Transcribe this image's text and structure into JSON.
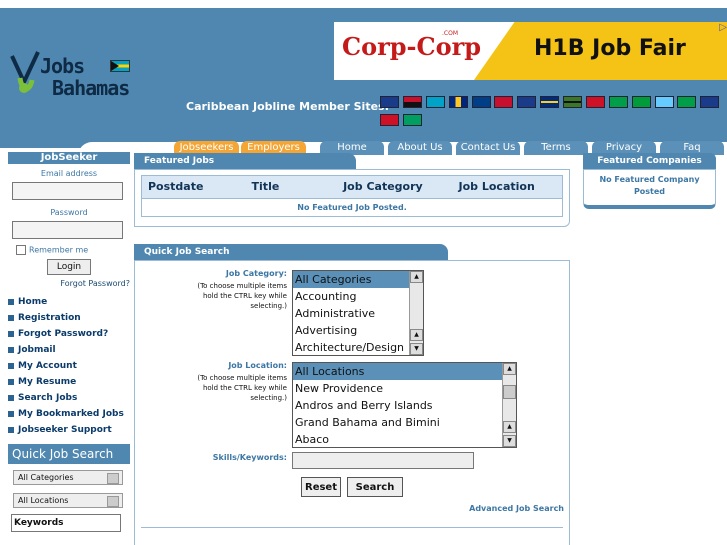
{
  "logo": {
    "line1": "Jobs",
    "line2": "Bahamas"
  },
  "ad": {
    "brand": "Corp-Corp",
    "brand_suffix": ".COM",
    "headline": "H1B Job Fair",
    "corner_icon": "ad-choices-icon"
  },
  "members": {
    "label": "Caribbean Jobline Member Sites:"
  },
  "nav": {
    "tabs": [
      {
        "label": "Jobseekers"
      },
      {
        "label": "Employers"
      },
      {
        "label": "Home"
      },
      {
        "label": "About Us"
      },
      {
        "label": "Contact Us"
      },
      {
        "label": "Terms"
      },
      {
        "label": "Privacy"
      },
      {
        "label": "Faq"
      }
    ]
  },
  "sidebar": {
    "title": "JobSeeker",
    "email_label": "Email address",
    "password_label": "Password",
    "remember_label": "Remember me",
    "login_label": "Login",
    "forgot_label": "Forgot Password?",
    "menu": [
      {
        "label": "Home"
      },
      {
        "label": "Registration"
      },
      {
        "label": "Forgot Password?"
      },
      {
        "label": "Jobmail"
      },
      {
        "label": "My Account"
      },
      {
        "label": "My Resume"
      },
      {
        "label": "Search Jobs"
      },
      {
        "label": "My Bookmarked Jobs"
      },
      {
        "label": "Jobseeker Support"
      }
    ],
    "quick_search_title": "Quick Job Search",
    "category_select": "All Categories",
    "location_select": "All Locations",
    "keywords_label": "Keywords"
  },
  "featured_jobs": {
    "title": "Featured Jobs",
    "columns": [
      "Postdate",
      "Title",
      "Job Category",
      "Job Location"
    ],
    "empty_message": "No Featured Job Posted."
  },
  "quick_search": {
    "title": "Quick Job Search",
    "category_label": "Job Category:",
    "category_note": "(To choose multiple items hold the CTRL key while selecting.)",
    "categories": [
      "All Categories",
      "Accounting",
      "Administrative",
      "Advertising",
      "Architecture/Design"
    ],
    "location_label": "Job Location:",
    "location_note": "(To choose multiple items hold the CTRL key while selecting.)",
    "locations": [
      "All Locations",
      "New Providence",
      "Andros and Berry Islands",
      "Grand Bahama and Bimini",
      "Abaco"
    ],
    "skills_label": "Skills/Keywords:",
    "skills_value": "",
    "reset_label": "Reset",
    "search_label": "Search",
    "advanced_label": "Advanced Job Search"
  },
  "featured_companies": {
    "title": "Featured Companies",
    "empty_message": "No Featured Company Posted"
  },
  "colors": {
    "header_bg": "#4f87b0",
    "tab_orange": "#f4a534",
    "accent": "#3d77a4"
  }
}
